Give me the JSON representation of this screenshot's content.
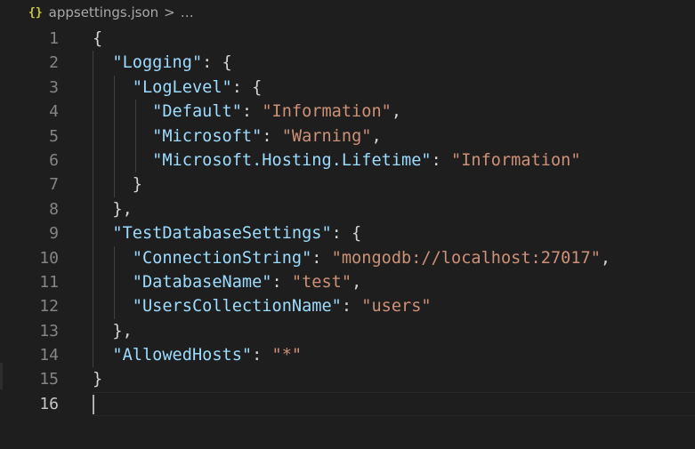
{
  "breadcrumb": {
    "icon": "{}",
    "file": "appsettings.json",
    "separator": ">",
    "more": "…"
  },
  "lines": [
    {
      "n": "1",
      "indent": "",
      "parts": [
        {
          "t": "{",
          "c": "p"
        }
      ]
    },
    {
      "n": "2",
      "indent": "  ",
      "parts": [
        {
          "t": "\"Logging\"",
          "c": "key"
        },
        {
          "t": ": {",
          "c": "p"
        }
      ]
    },
    {
      "n": "3",
      "indent": "    ",
      "parts": [
        {
          "t": "\"LogLevel\"",
          "c": "key"
        },
        {
          "t": ": {",
          "c": "p"
        }
      ]
    },
    {
      "n": "4",
      "indent": "      ",
      "parts": [
        {
          "t": "\"Default\"",
          "c": "key"
        },
        {
          "t": ": ",
          "c": "p"
        },
        {
          "t": "\"Information\"",
          "c": "str"
        },
        {
          "t": ",",
          "c": "p"
        }
      ]
    },
    {
      "n": "5",
      "indent": "      ",
      "parts": [
        {
          "t": "\"Microsoft\"",
          "c": "key"
        },
        {
          "t": ": ",
          "c": "p"
        },
        {
          "t": "\"Warning\"",
          "c": "str"
        },
        {
          "t": ",",
          "c": "p"
        }
      ]
    },
    {
      "n": "6",
      "indent": "      ",
      "parts": [
        {
          "t": "\"Microsoft.Hosting.Lifetime\"",
          "c": "key"
        },
        {
          "t": ": ",
          "c": "p"
        },
        {
          "t": "\"Information\"",
          "c": "str"
        }
      ]
    },
    {
      "n": "7",
      "indent": "    ",
      "parts": [
        {
          "t": "}",
          "c": "p"
        }
      ]
    },
    {
      "n": "8",
      "indent": "  ",
      "parts": [
        {
          "t": "},",
          "c": "p"
        }
      ]
    },
    {
      "n": "9",
      "indent": "  ",
      "parts": [
        {
          "t": "\"TestDatabaseSettings\"",
          "c": "key"
        },
        {
          "t": ": {",
          "c": "p"
        }
      ]
    },
    {
      "n": "10",
      "indent": "    ",
      "parts": [
        {
          "t": "\"ConnectionString\"",
          "c": "key"
        },
        {
          "t": ": ",
          "c": "p"
        },
        {
          "t": "\"mongodb://localhost:27017\"",
          "c": "str"
        },
        {
          "t": ",",
          "c": "p"
        }
      ]
    },
    {
      "n": "11",
      "indent": "    ",
      "parts": [
        {
          "t": "\"DatabaseName\"",
          "c": "key"
        },
        {
          "t": ": ",
          "c": "p"
        },
        {
          "t": "\"test\"",
          "c": "str"
        },
        {
          "t": ",",
          "c": "p"
        }
      ]
    },
    {
      "n": "12",
      "indent": "    ",
      "parts": [
        {
          "t": "\"UsersCollectionName\"",
          "c": "key"
        },
        {
          "t": ": ",
          "c": "p"
        },
        {
          "t": "\"users\"",
          "c": "str"
        }
      ]
    },
    {
      "n": "13",
      "indent": "  ",
      "parts": [
        {
          "t": "},",
          "c": "p"
        }
      ]
    },
    {
      "n": "14",
      "indent": "  ",
      "parts": [
        {
          "t": "\"AllowedHosts\"",
          "c": "key"
        },
        {
          "t": ": ",
          "c": "p"
        },
        {
          "t": "\"*\"",
          "c": "str"
        }
      ]
    },
    {
      "n": "15",
      "indent": "",
      "parts": [
        {
          "t": "}",
          "c": "p"
        }
      ]
    },
    {
      "n": "16",
      "indent": "",
      "parts": []
    }
  ],
  "active_line": "16",
  "colors": {
    "background": "#1e1e1e",
    "key": "#9cdcfe",
    "string": "#ce9178",
    "punctuation": "#d4d4d4",
    "line_number": "#858585",
    "json_icon": "#cbcb41"
  }
}
